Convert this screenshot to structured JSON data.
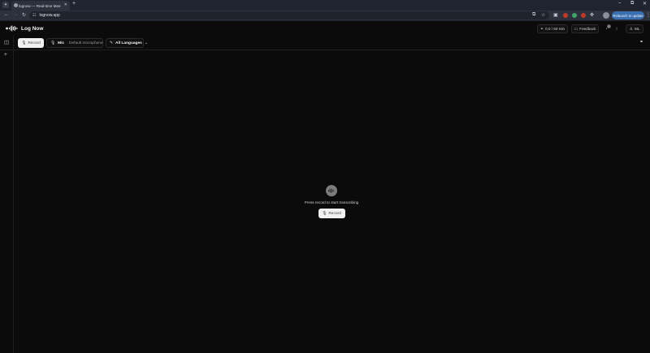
{
  "browser": {
    "tab_title": "lognow — Real-time Meeting",
    "new_tab_symbol": "+",
    "url": "lognow.app",
    "relaunch_label": "Relaunch to update",
    "window_controls": {
      "minimize": "–",
      "maximize": "⧉",
      "close": "✕"
    },
    "extension_colors": [
      "#c0392b",
      "#3fa56b",
      "#c0392b"
    ]
  },
  "app": {
    "brand": "Log Now",
    "header": {
      "usage_label": "0.0 / 60 min",
      "feedback_label": "Feedback",
      "notification_count": "0",
      "user_label": "ML"
    },
    "toolbar": {
      "record_label": "Record",
      "mic_label": "Mic",
      "mic_value": "· Default microphone",
      "language_value": "All Languages"
    },
    "empty_state": {
      "message": "Press record to start transcribing",
      "record_label": "Record"
    }
  }
}
